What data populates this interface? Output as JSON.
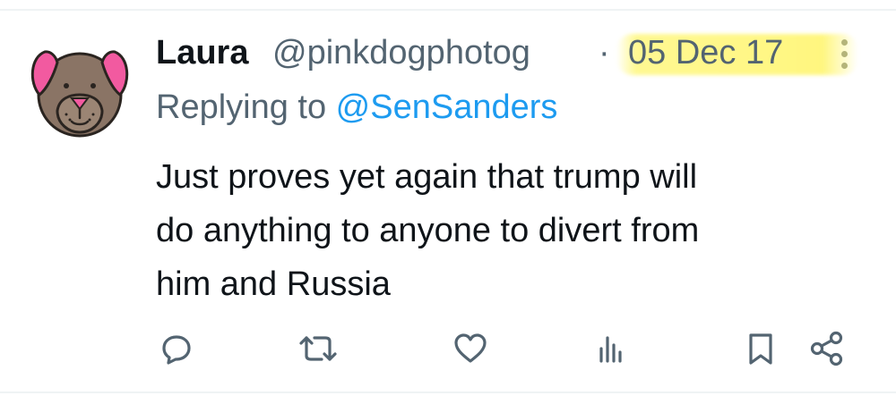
{
  "tweet": {
    "author_name": "Laura",
    "author_handle": "@pinkdogphotog",
    "separator": "·",
    "timestamp": "05 Dec 17",
    "replying_prefix": "Replying to ",
    "replying_to": "@SenSanders",
    "text_lines": [
      "Just proves yet again that trump will",
      "do anything to anyone to divert from",
      "him and Russia"
    ]
  },
  "icons": {
    "reply": "reply-icon",
    "retweet": "retweet-icon",
    "like": "like-icon",
    "views": "views-icon",
    "bookmark": "bookmark-icon",
    "share": "share-icon",
    "more": "more-options-icon"
  },
  "colors": {
    "primary_text": "#0f1419",
    "secondary_text": "#536471",
    "mention": "#1d9bf0",
    "highlight": "#fff678",
    "avatar_ears": "#f25aa0",
    "avatar_face": "#8a7465"
  }
}
